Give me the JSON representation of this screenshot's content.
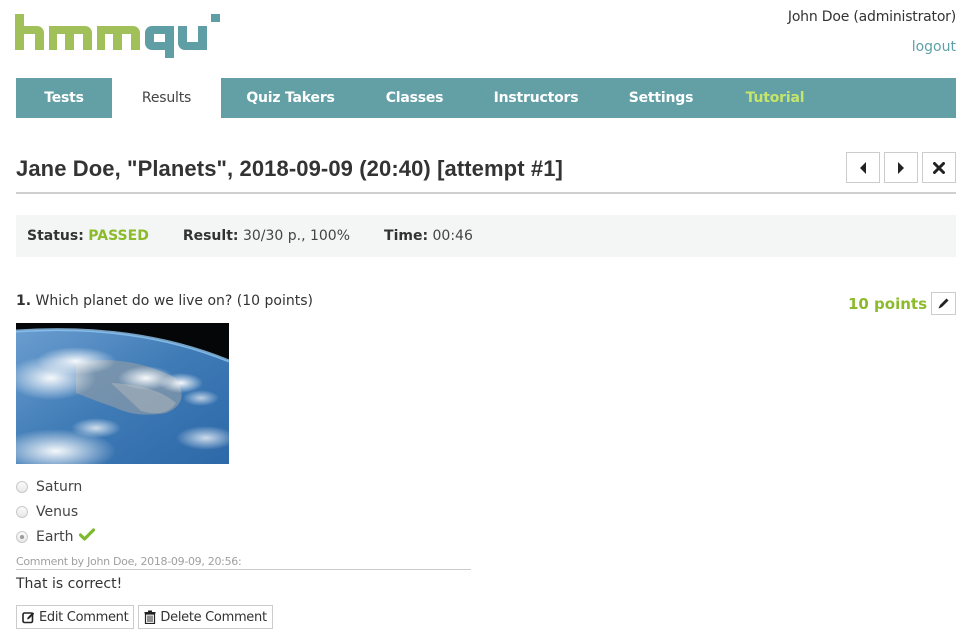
{
  "brand": {
    "logo_part1": "hmm",
    "logo_part2": "quiz",
    "color_green": "#a2c05a",
    "color_teal": "#5f9ea5"
  },
  "user": {
    "name": "John Doe (administrator)",
    "logout_label": "logout"
  },
  "nav": {
    "items": [
      {
        "label": "Tests",
        "active": false
      },
      {
        "label": "Results",
        "active": true
      },
      {
        "label": "Quiz Takers",
        "active": false
      },
      {
        "label": "Classes",
        "active": false
      },
      {
        "label": "Instructors",
        "active": false
      },
      {
        "label": "Settings",
        "active": false
      },
      {
        "label": "Tutorial",
        "active": false,
        "highlight": true
      }
    ]
  },
  "page": {
    "title": "Jane Doe, \"Planets\", 2018-09-09 (20:40) [attempt #1]",
    "prev_icon": "caret-left-icon",
    "next_icon": "caret-right-icon",
    "close_icon": "close-icon"
  },
  "status": {
    "status_label": "Status:",
    "status_value": "PASSED",
    "result_label": "Result:",
    "result_value": "30/30 p., 100%",
    "time_label": "Time:",
    "time_value": "00:46"
  },
  "question": {
    "number": "1.",
    "text": "Which planet do we live on? (10 points)",
    "points_awarded": "10 points",
    "edit_icon": "pencil-icon",
    "image_alt": "Earth from orbit",
    "answers": [
      {
        "label": "Saturn",
        "selected": false,
        "correct": false
      },
      {
        "label": "Venus",
        "selected": false,
        "correct": false
      },
      {
        "label": "Earth",
        "selected": true,
        "correct": true
      }
    ]
  },
  "comment": {
    "meta": "Comment by John Doe, 2018-09-09, 20:56:",
    "text": "That is correct!",
    "edit_label": "Edit Comment",
    "delete_label": "Delete Comment"
  },
  "colors": {
    "accent_teal": "#63a0a6",
    "passed_green": "#8bbb2a",
    "tutorial_green": "#c5e56b",
    "link": "#5fa0a8"
  }
}
